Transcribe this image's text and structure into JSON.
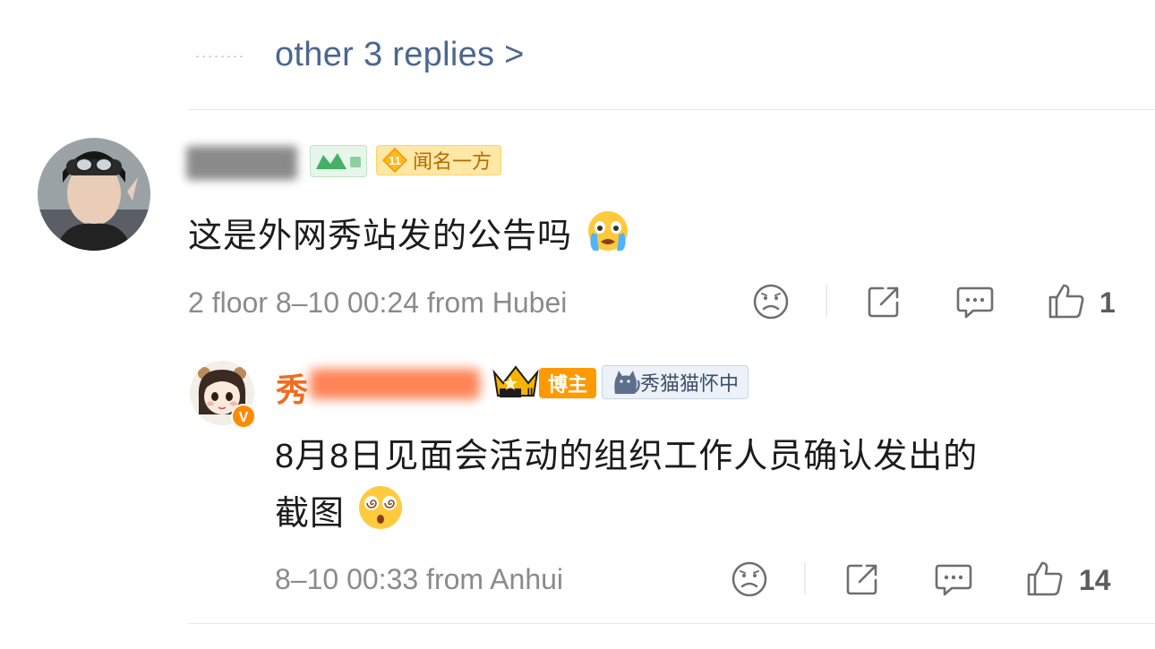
{
  "thread": {
    "more_replies_label": "other 3 replies >"
  },
  "comment": {
    "user": {
      "name_censored": true,
      "badges": {
        "level_number": "11",
        "title_badge_label": "闻名一方"
      }
    },
    "text": "这是外网秀站发的公告吗",
    "emoji": "crying-face",
    "meta": "2 floor 8–10 00:24  from Hubei",
    "likes": "1"
  },
  "reply": {
    "user": {
      "name_visible_prefix": "秀",
      "verified": true,
      "blogger_badge_label": "博主",
      "fan_badge_label": "秀猫猫怀中"
    },
    "text_line1": "8月8日见面会活动的组织工作人员确认发出的",
    "text_line2": "截图",
    "emoji": "dizzy-face",
    "meta": "8–10 00:33  from Anhui",
    "likes": "14"
  },
  "colors": {
    "link_blue": "#4a6790",
    "name_orange": "#f26b1d",
    "meta_grey": "#8b8b8b",
    "icon_grey": "#6e6e6e"
  }
}
